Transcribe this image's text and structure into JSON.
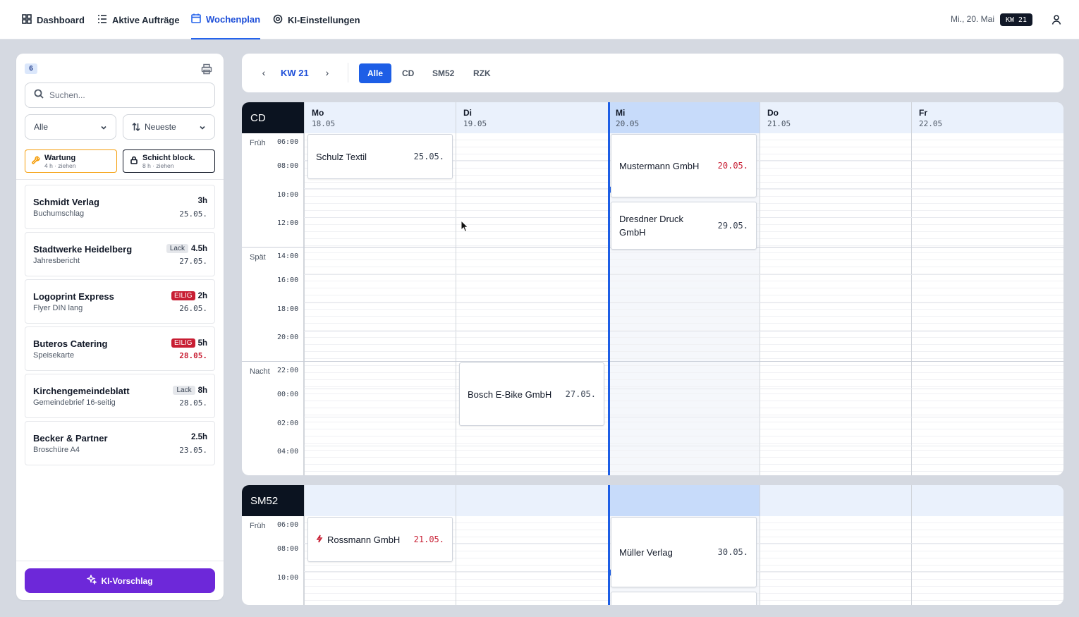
{
  "nav": {
    "items": [
      {
        "label": "Dashboard",
        "icon": "dashboard-icon"
      },
      {
        "label": "Aktive Aufträge",
        "icon": "list-icon"
      },
      {
        "label": "Wochenplan",
        "icon": "calendar-icon",
        "active": true
      },
      {
        "label": "KI-Einstellungen",
        "icon": "gear-icon"
      }
    ],
    "date": "Mi., 20. Mai",
    "kw_badge": "KW 21"
  },
  "sidebar": {
    "count": "6",
    "search_placeholder": "Suchen...",
    "filter_select": "Alle",
    "sort_select": "Neueste",
    "blocks": [
      {
        "title": "Wartung",
        "sub": "4 h · ziehen",
        "icon": "wrench-icon",
        "color": "#f59e0b"
      },
      {
        "title": "Schicht block.",
        "sub": "8 h · ziehen",
        "icon": "lock-icon",
        "color": "#111827"
      }
    ],
    "jobs": [
      {
        "name": "Schmidt Verlag",
        "desc": "Buchumschlag",
        "tag": "",
        "hours": "3h",
        "due": "25.05.",
        "late": false
      },
      {
        "name": "Stadtwerke Heidelberg",
        "desc": "Jahresbericht",
        "tag": "Lack",
        "hours": "4.5h",
        "due": "27.05.",
        "late": false
      },
      {
        "name": "Logoprint Express",
        "desc": "Flyer DIN lang",
        "tag": "EILIG",
        "hours": "2h",
        "due": "26.05.",
        "late": false
      },
      {
        "name": "Buteros Catering",
        "desc": "Speisekarte",
        "tag": "EILIG",
        "hours": "5h",
        "due": "28.05.",
        "late": true
      },
      {
        "name": "Kirchengemeindeblatt",
        "desc": "Gemeindebrief 16-seitig",
        "tag": "Lack",
        "hours": "8h",
        "due": "28.05.",
        "late": false
      },
      {
        "name": "Becker & Partner",
        "desc": "Broschüre A4",
        "tag": "",
        "hours": "2.5h",
        "due": "23.05.",
        "late": false
      }
    ],
    "ki_button": "KI-Vorschlag"
  },
  "toolbar": {
    "prev": "‹",
    "next": "›",
    "week": "KW 21",
    "filters": [
      "Alle",
      "CD",
      "SM52",
      "RZK"
    ],
    "active_filter": "Alle"
  },
  "days": [
    {
      "name": "Mo",
      "date": "18.05"
    },
    {
      "name": "Di",
      "date": "19.05"
    },
    {
      "name": "Mi",
      "date": "20.05",
      "today": true
    },
    {
      "name": "Do",
      "date": "21.05"
    },
    {
      "name": "Fr",
      "date": "22.05"
    }
  ],
  "shifts": [
    "Früh",
    "Spät",
    "Nacht"
  ],
  "times": [
    "06:00",
    "08:00",
    "10:00",
    "12:00",
    "14:00",
    "16:00",
    "18:00",
    "20:00",
    "22:00",
    "00:00",
    "02:00",
    "04:00"
  ],
  "machines": [
    {
      "name": "CD",
      "orders": [
        {
          "name": "Schulz Textil",
          "due": "25.05.",
          "late": false
        },
        {
          "name": "Mustermann GmbH",
          "due": "20.05.",
          "late": true
        },
        {
          "name": "Dresdner Druck GmbH",
          "due": "29.05.",
          "late": false
        },
        {
          "name": "Bosch E-Bike GmbH",
          "due": "27.05.",
          "late": false
        }
      ]
    },
    {
      "name": "SM52",
      "orders": [
        {
          "name": "Rossmann GmbH",
          "due": "21.05.",
          "late": true,
          "urgent_icon": "bolt-icon"
        },
        {
          "name": "Müller Verlag",
          "due": "30.05.",
          "late": false
        }
      ]
    }
  ],
  "colors": {
    "accent": "#1d5ee6",
    "urgent": "#c81e33",
    "ki": "#6d28d9",
    "machine_label": "#0b1320"
  }
}
